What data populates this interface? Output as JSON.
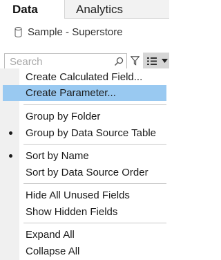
{
  "tabs": {
    "data_label": "Data",
    "analytics_label": "Analytics"
  },
  "datasource": {
    "name": "Sample - Superstore",
    "icon": "database-icon"
  },
  "search": {
    "placeholder": "Search",
    "value": ""
  },
  "toolbar": {
    "filter_icon": "filter-icon",
    "view_icon": "list-view-icon",
    "menu_icon": "dropdown-arrow-icon"
  },
  "menu": {
    "highlight_color": "#99c9f1",
    "items": [
      {
        "label": "Create Calculated Field...",
        "checked": false,
        "highlighted": false
      },
      {
        "label": "Create Parameter...",
        "checked": false,
        "highlighted": true
      },
      {
        "label": "Group by Folder",
        "checked": false,
        "highlighted": false
      },
      {
        "label": "Group by Data Source Table",
        "checked": true,
        "highlighted": false
      },
      {
        "label": "Sort by Name",
        "checked": true,
        "highlighted": false
      },
      {
        "label": "Sort by Data Source Order",
        "checked": false,
        "highlighted": false
      },
      {
        "label": "Hide All Unused Fields",
        "checked": false,
        "highlighted": false
      },
      {
        "label": "Show Hidden Fields",
        "checked": false,
        "highlighted": false
      },
      {
        "label": "Expand All",
        "checked": false,
        "highlighted": false
      },
      {
        "label": "Collapse All",
        "checked": false,
        "highlighted": false
      }
    ]
  }
}
